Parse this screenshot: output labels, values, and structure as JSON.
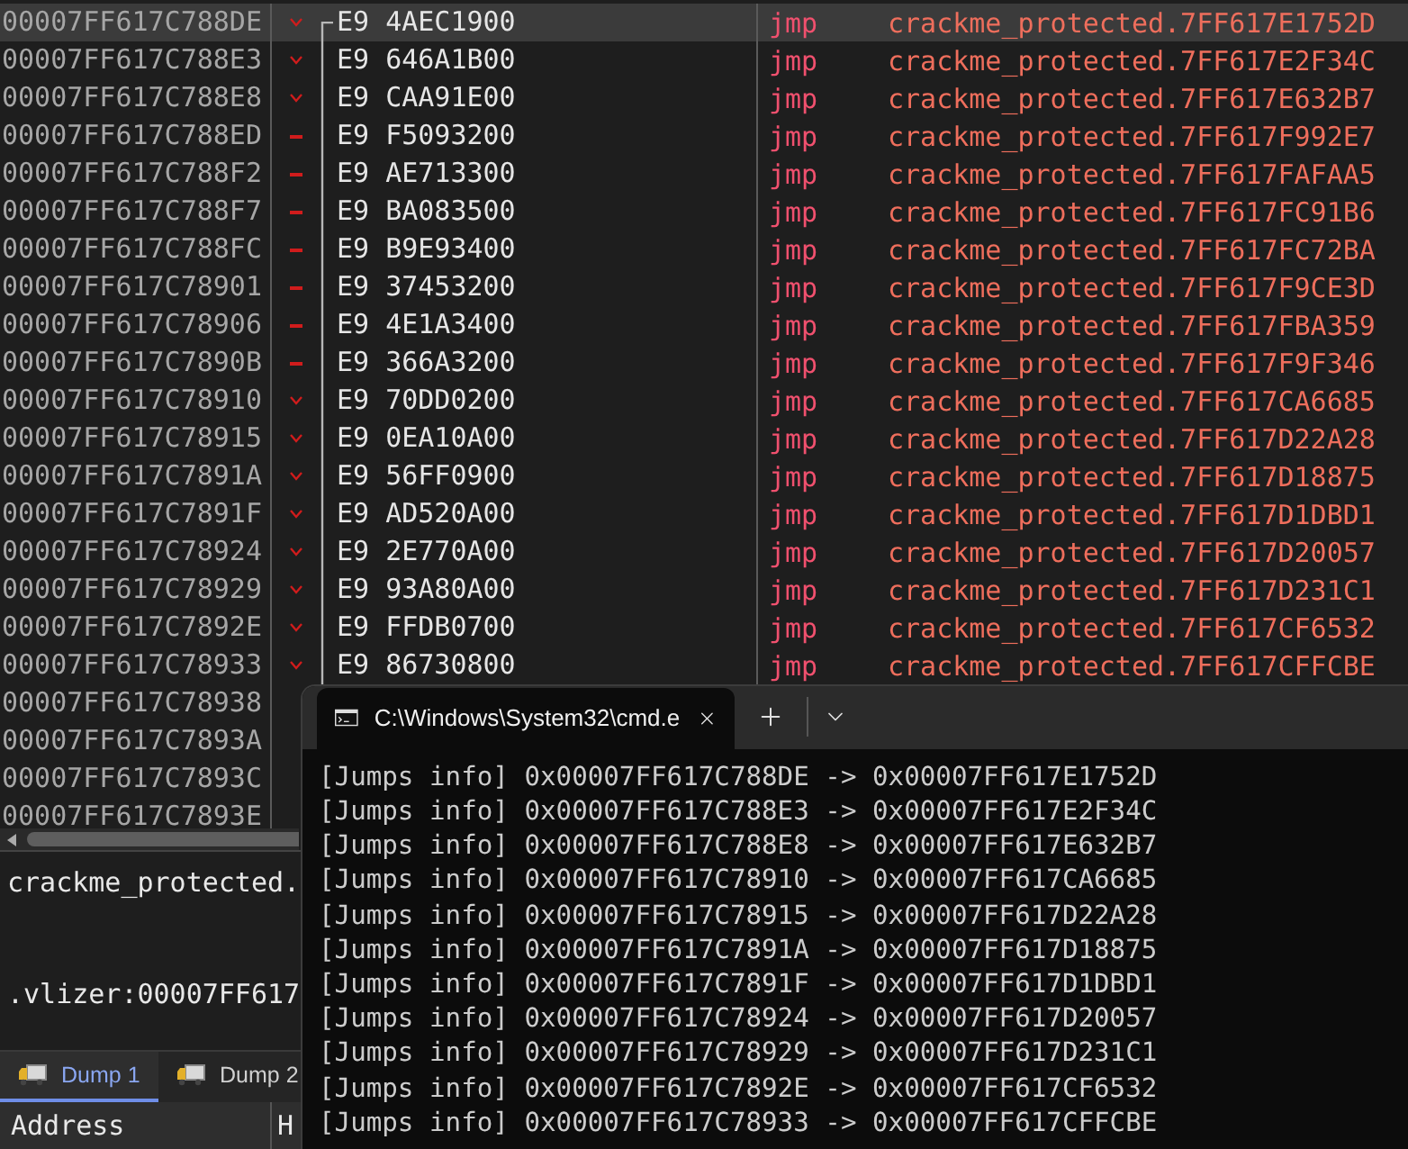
{
  "disassembly": {
    "rows": [
      {
        "address": "00007FF617C788DE",
        "kind": "arrow",
        "bytes": "E9 4AEC1900",
        "mnemonic": "jmp",
        "operand": "crackme_protected.7FF617E1752D",
        "selected": true
      },
      {
        "address": "00007FF617C788E3",
        "kind": "arrow",
        "bytes": "E9 646A1B00",
        "mnemonic": "jmp",
        "operand": "crackme_protected.7FF617E2F34C",
        "selected": false
      },
      {
        "address": "00007FF617C788E8",
        "kind": "arrow",
        "bytes": "E9 CAA91E00",
        "mnemonic": "jmp",
        "operand": "crackme_protected.7FF617E632B7",
        "selected": false
      },
      {
        "address": "00007FF617C788ED",
        "kind": "dash",
        "bytes": "E9 F5093200",
        "mnemonic": "jmp",
        "operand": "crackme_protected.7FF617F992E7",
        "selected": false
      },
      {
        "address": "00007FF617C788F2",
        "kind": "dash",
        "bytes": "E9 AE713300",
        "mnemonic": "jmp",
        "operand": "crackme_protected.7FF617FAFAA5",
        "selected": false
      },
      {
        "address": "00007FF617C788F7",
        "kind": "dash",
        "bytes": "E9 BA083500",
        "mnemonic": "jmp",
        "operand": "crackme_protected.7FF617FC91B6",
        "selected": false
      },
      {
        "address": "00007FF617C788FC",
        "kind": "dash",
        "bytes": "E9 B9E93400",
        "mnemonic": "jmp",
        "operand": "crackme_protected.7FF617FC72BA",
        "selected": false
      },
      {
        "address": "00007FF617C78901",
        "kind": "dash",
        "bytes": "E9 37453200",
        "mnemonic": "jmp",
        "operand": "crackme_protected.7FF617F9CE3D",
        "selected": false
      },
      {
        "address": "00007FF617C78906",
        "kind": "dash",
        "bytes": "E9 4E1A3400",
        "mnemonic": "jmp",
        "operand": "crackme_protected.7FF617FBA359",
        "selected": false
      },
      {
        "address": "00007FF617C7890B",
        "kind": "dash",
        "bytes": "E9 366A3200",
        "mnemonic": "jmp",
        "operand": "crackme_protected.7FF617F9F346",
        "selected": false
      },
      {
        "address": "00007FF617C78910",
        "kind": "arrow",
        "bytes": "E9 70DD0200",
        "mnemonic": "jmp",
        "operand": "crackme_protected.7FF617CA6685",
        "selected": false
      },
      {
        "address": "00007FF617C78915",
        "kind": "arrow",
        "bytes": "E9 0EA10A00",
        "mnemonic": "jmp",
        "operand": "crackme_protected.7FF617D22A28",
        "selected": false
      },
      {
        "address": "00007FF617C7891A",
        "kind": "arrow",
        "bytes": "E9 56FF0900",
        "mnemonic": "jmp",
        "operand": "crackme_protected.7FF617D18875",
        "selected": false
      },
      {
        "address": "00007FF617C7891F",
        "kind": "arrow",
        "bytes": "E9 AD520A00",
        "mnemonic": "jmp",
        "operand": "crackme_protected.7FF617D1DBD1",
        "selected": false
      },
      {
        "address": "00007FF617C78924",
        "kind": "arrow",
        "bytes": "E9 2E770A00",
        "mnemonic": "jmp",
        "operand": "crackme_protected.7FF617D20057",
        "selected": false
      },
      {
        "address": "00007FF617C78929",
        "kind": "arrow",
        "bytes": "E9 93A80A00",
        "mnemonic": "jmp",
        "operand": "crackme_protected.7FF617D231C1",
        "selected": false
      },
      {
        "address": "00007FF617C7892E",
        "kind": "arrow",
        "bytes": "E9 FFDB0700",
        "mnemonic": "jmp",
        "operand": "crackme_protected.7FF617CF6532",
        "selected": false
      },
      {
        "address": "00007FF617C78933",
        "kind": "arrow",
        "bytes": "E9 86730800",
        "mnemonic": "jmp",
        "operand": "crackme_protected.7FF617CFFCBE",
        "selected": false
      },
      {
        "address": "00007FF617C78938",
        "selected": false
      },
      {
        "address": "00007FF617C7893A",
        "selected": false
      },
      {
        "address": "00007FF617C7893C",
        "selected": false
      },
      {
        "address": "00007FF617C7893E",
        "selected": false
      }
    ]
  },
  "info_panel": {
    "lines": [
      "crackme_protected.",
      ".vlizer:00007FF617"
    ]
  },
  "dump_tabs": [
    {
      "label": "Dump 1",
      "selected": true
    },
    {
      "label": "Dump 2",
      "selected": false
    }
  ],
  "dump_table": {
    "columns": [
      "Address",
      "H"
    ]
  },
  "terminal": {
    "tab_title": "C:\\Windows\\System32\\cmd.e",
    "lines": [
      "[Jumps info] 0x00007FF617C788DE -> 0x00007FF617E1752D",
      "[Jumps info] 0x00007FF617C788E3 -> 0x00007FF617E2F34C",
      "[Jumps info] 0x00007FF617C788E8 -> 0x00007FF617E632B7",
      "[Jumps info] 0x00007FF617C78910 -> 0x00007FF617CA6685",
      "[Jumps info] 0x00007FF617C78915 -> 0x00007FF617D22A28",
      "[Jumps info] 0x00007FF617C7891A -> 0x00007FF617D18875",
      "[Jumps info] 0x00007FF617C7891F -> 0x00007FF617D1DBD1",
      "[Jumps info] 0x00007FF617C78924 -> 0x00007FF617D20057",
      "[Jumps info] 0x00007FF617C78929 -> 0x00007FF617D231C1",
      "[Jumps info] 0x00007FF617C7892E -> 0x00007FF617CF6532",
      "[Jumps info] 0x00007FF617C78933 -> 0x00007FF617CFFCBE"
    ]
  }
}
